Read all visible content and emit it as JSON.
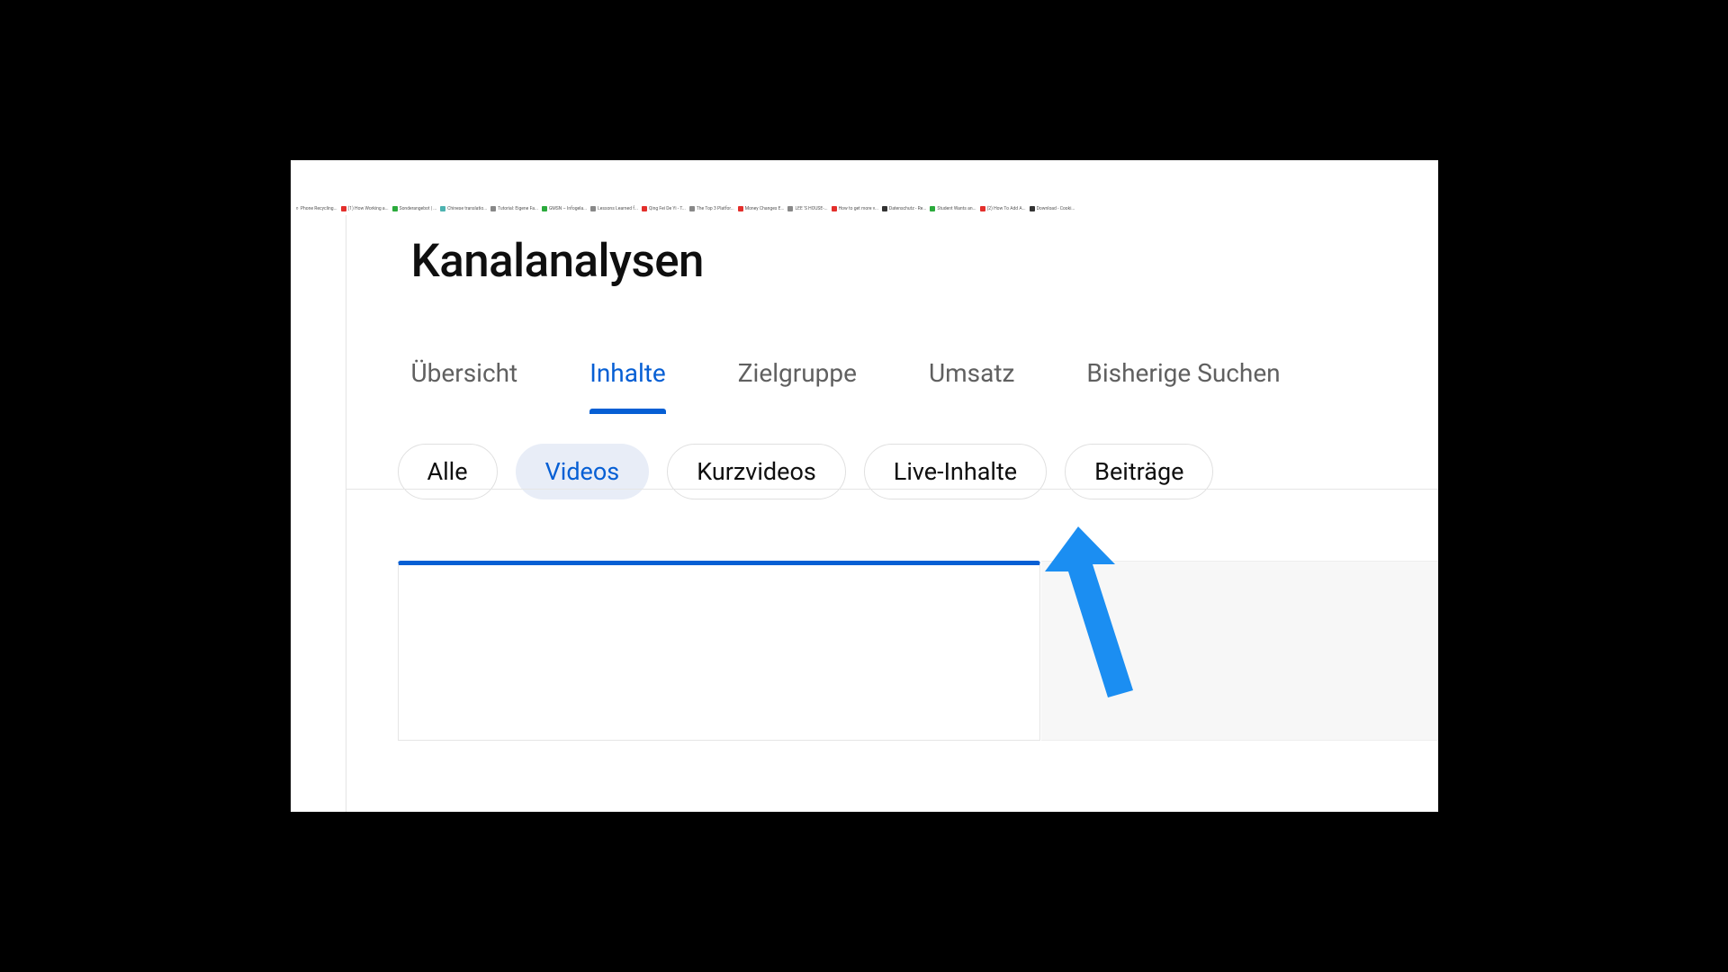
{
  "page_title": "Kanalanalysen",
  "bookmarks": [
    {
      "label": "Phone Recycling...",
      "icon": "search"
    },
    {
      "label": "(1) How Working a...",
      "color": "red"
    },
    {
      "label": "Sonderangebot | ...",
      "color": "green"
    },
    {
      "label": "Chinese translatio...",
      "color": "teal"
    },
    {
      "label": "Tutorial: Eigene Fa...",
      "color": "gray"
    },
    {
      "label": "GMSN – Infogela...",
      "color": "green"
    },
    {
      "label": "Lessons Learned f...",
      "color": "gray"
    },
    {
      "label": "Qing Fei De Yi - T...",
      "color": "red"
    },
    {
      "label": "The Top 3 Platfor...",
      "color": "gray"
    },
    {
      "label": "Money Changes E...",
      "color": "red"
    },
    {
      "label": "LEE 'S HOUSE-...",
      "color": "gray"
    },
    {
      "label": "How to get more v...",
      "color": "red"
    },
    {
      "label": "Datenschutz - Re...",
      "color": "dark"
    },
    {
      "label": "Student Wants an...",
      "color": "green"
    },
    {
      "label": "(2) How To Add A...",
      "color": "red"
    },
    {
      "label": "Download - Cooki...",
      "color": "dark"
    }
  ],
  "tabs": [
    {
      "key": "overview",
      "label": "Übersicht",
      "active": false
    },
    {
      "key": "content",
      "label": "Inhalte",
      "active": true
    },
    {
      "key": "audience",
      "label": "Zielgruppe",
      "active": false
    },
    {
      "key": "revenue",
      "label": "Umsatz",
      "active": false
    },
    {
      "key": "research",
      "label": "Bisherige Suchen",
      "active": false
    }
  ],
  "chips": [
    {
      "key": "all",
      "label": "Alle",
      "active": false
    },
    {
      "key": "videos",
      "label": "Videos",
      "active": true
    },
    {
      "key": "shorts",
      "label": "Kurzvideos",
      "active": false
    },
    {
      "key": "live",
      "label": "Live-Inhalte",
      "active": false
    },
    {
      "key": "posts",
      "label": "Beiträge",
      "active": false
    }
  ],
  "colors": {
    "accent": "#065fd4",
    "arrow": "#1b8ef2"
  }
}
